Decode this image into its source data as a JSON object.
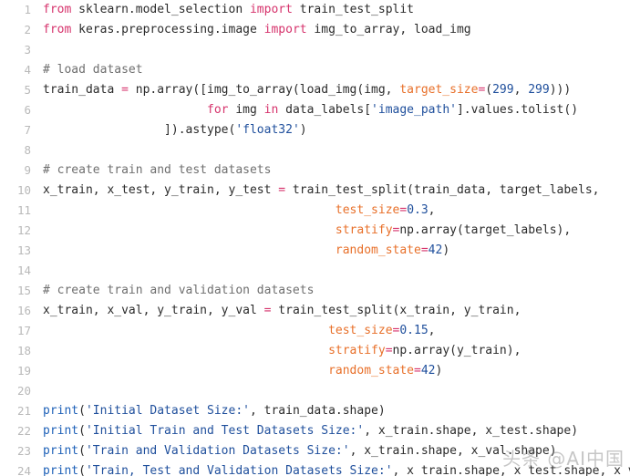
{
  "editor": {
    "language": "python",
    "background_color": "#ffffff",
    "gutter_color": "#b9b9b9",
    "first_line_number": 1,
    "last_line_number": 24,
    "total_visible_lines": 24
  },
  "theme": {
    "keyword": "#d6336c",
    "comment": "#6f6f6f",
    "string": "#1f4f9c",
    "number": "#1f4f9c",
    "builtin": "#2062b8",
    "kwarg": "#e8702a",
    "operator": "#d6336c",
    "plain": "#2b2b2b"
  },
  "watermark": {
    "text": "头条 @AI中国"
  },
  "lines": [
    {
      "n": "1",
      "tokens": [
        {
          "t": "kw",
          "v": "from"
        },
        {
          "t": "pln",
          "v": " sklearn.model_selection "
        },
        {
          "t": "kw",
          "v": "import"
        },
        {
          "t": "pln",
          "v": " train_test_split"
        }
      ]
    },
    {
      "n": "2",
      "tokens": [
        {
          "t": "kw",
          "v": "from"
        },
        {
          "t": "pln",
          "v": " keras.preprocessing.image "
        },
        {
          "t": "kw",
          "v": "import"
        },
        {
          "t": "pln",
          "v": " img_to_array, load_img"
        }
      ]
    },
    {
      "n": "3",
      "tokens": []
    },
    {
      "n": "4",
      "tokens": [
        {
          "t": "com",
          "v": "# load dataset"
        }
      ]
    },
    {
      "n": "5",
      "tokens": [
        {
          "t": "pln",
          "v": "train_data "
        },
        {
          "t": "op",
          "v": "="
        },
        {
          "t": "pln",
          "v": " np.array([img_to_array(load_img(img, "
        },
        {
          "t": "kwarg",
          "v": "target_size"
        },
        {
          "t": "op",
          "v": "="
        },
        {
          "t": "pln",
          "v": "("
        },
        {
          "t": "num",
          "v": "299"
        },
        {
          "t": "pln",
          "v": ", "
        },
        {
          "t": "num",
          "v": "299"
        },
        {
          "t": "pln",
          "v": ")))"
        }
      ]
    },
    {
      "n": "6",
      "tokens": [
        {
          "t": "pln",
          "v": "                       "
        },
        {
          "t": "kw",
          "v": "for"
        },
        {
          "t": "pln",
          "v": " img "
        },
        {
          "t": "kw",
          "v": "in"
        },
        {
          "t": "pln",
          "v": " data_labels["
        },
        {
          "t": "str",
          "v": "'image_path'"
        },
        {
          "t": "pln",
          "v": "].values.tolist()"
        }
      ]
    },
    {
      "n": "7",
      "tokens": [
        {
          "t": "pln",
          "v": "                 ]).astype("
        },
        {
          "t": "str",
          "v": "'float32'"
        },
        {
          "t": "pln",
          "v": ")"
        }
      ]
    },
    {
      "n": "8",
      "tokens": []
    },
    {
      "n": "9",
      "tokens": [
        {
          "t": "com",
          "v": "# create train and test datasets"
        }
      ]
    },
    {
      "n": "10",
      "tokens": [
        {
          "t": "pln",
          "v": "x_train, x_test, y_train, y_test "
        },
        {
          "t": "op",
          "v": "="
        },
        {
          "t": "pln",
          "v": " train_test_split(train_data, target_labels,"
        }
      ]
    },
    {
      "n": "11",
      "tokens": [
        {
          "t": "pln",
          "v": "                                         "
        },
        {
          "t": "kwarg",
          "v": "test_size"
        },
        {
          "t": "op",
          "v": "="
        },
        {
          "t": "num",
          "v": "0.3"
        },
        {
          "t": "pln",
          "v": ","
        }
      ]
    },
    {
      "n": "12",
      "tokens": [
        {
          "t": "pln",
          "v": "                                         "
        },
        {
          "t": "kwarg",
          "v": "stratify"
        },
        {
          "t": "op",
          "v": "="
        },
        {
          "t": "pln",
          "v": "np.array(target_labels),"
        }
      ]
    },
    {
      "n": "13",
      "tokens": [
        {
          "t": "pln",
          "v": "                                         "
        },
        {
          "t": "kwarg",
          "v": "random_state"
        },
        {
          "t": "op",
          "v": "="
        },
        {
          "t": "num",
          "v": "42"
        },
        {
          "t": "pln",
          "v": ")"
        }
      ]
    },
    {
      "n": "14",
      "tokens": []
    },
    {
      "n": "15",
      "tokens": [
        {
          "t": "com",
          "v": "# create train and validation datasets"
        }
      ]
    },
    {
      "n": "16",
      "tokens": [
        {
          "t": "pln",
          "v": "x_train, x_val, y_train, y_val "
        },
        {
          "t": "op",
          "v": "="
        },
        {
          "t": "pln",
          "v": " train_test_split(x_train, y_train,"
        }
      ]
    },
    {
      "n": "17",
      "tokens": [
        {
          "t": "pln",
          "v": "                                        "
        },
        {
          "t": "kwarg",
          "v": "test_size"
        },
        {
          "t": "op",
          "v": "="
        },
        {
          "t": "num",
          "v": "0.15"
        },
        {
          "t": "pln",
          "v": ","
        }
      ]
    },
    {
      "n": "18",
      "tokens": [
        {
          "t": "pln",
          "v": "                                        "
        },
        {
          "t": "kwarg",
          "v": "stratify"
        },
        {
          "t": "op",
          "v": "="
        },
        {
          "t": "pln",
          "v": "np.array(y_train),"
        }
      ]
    },
    {
      "n": "19",
      "tokens": [
        {
          "t": "pln",
          "v": "                                        "
        },
        {
          "t": "kwarg",
          "v": "random_state"
        },
        {
          "t": "op",
          "v": "="
        },
        {
          "t": "num",
          "v": "42"
        },
        {
          "t": "pln",
          "v": ")"
        }
      ]
    },
    {
      "n": "20",
      "tokens": []
    },
    {
      "n": "21",
      "tokens": [
        {
          "t": "bif",
          "v": "print"
        },
        {
          "t": "pln",
          "v": "("
        },
        {
          "t": "str",
          "v": "'Initial Dataset Size:'"
        },
        {
          "t": "pln",
          "v": ", train_data.shape)"
        }
      ]
    },
    {
      "n": "22",
      "tokens": [
        {
          "t": "bif",
          "v": "print"
        },
        {
          "t": "pln",
          "v": "("
        },
        {
          "t": "str",
          "v": "'Initial Train and Test Datasets Size:'"
        },
        {
          "t": "pln",
          "v": ", x_train.shape, x_test.shape)"
        }
      ]
    },
    {
      "n": "23",
      "tokens": [
        {
          "t": "bif",
          "v": "print"
        },
        {
          "t": "pln",
          "v": "("
        },
        {
          "t": "str",
          "v": "'Train and Validation Datasets Size:'"
        },
        {
          "t": "pln",
          "v": ", x_train.shape, x_val.shape)"
        }
      ]
    },
    {
      "n": "24",
      "tokens": [
        {
          "t": "bif",
          "v": "print"
        },
        {
          "t": "pln",
          "v": "("
        },
        {
          "t": "str",
          "v": "'Train, Test and Validation Datasets Size:'"
        },
        {
          "t": "pln",
          "v": ", x_train.shape, x_test.shape, x_val.shape)"
        }
      ]
    }
  ]
}
